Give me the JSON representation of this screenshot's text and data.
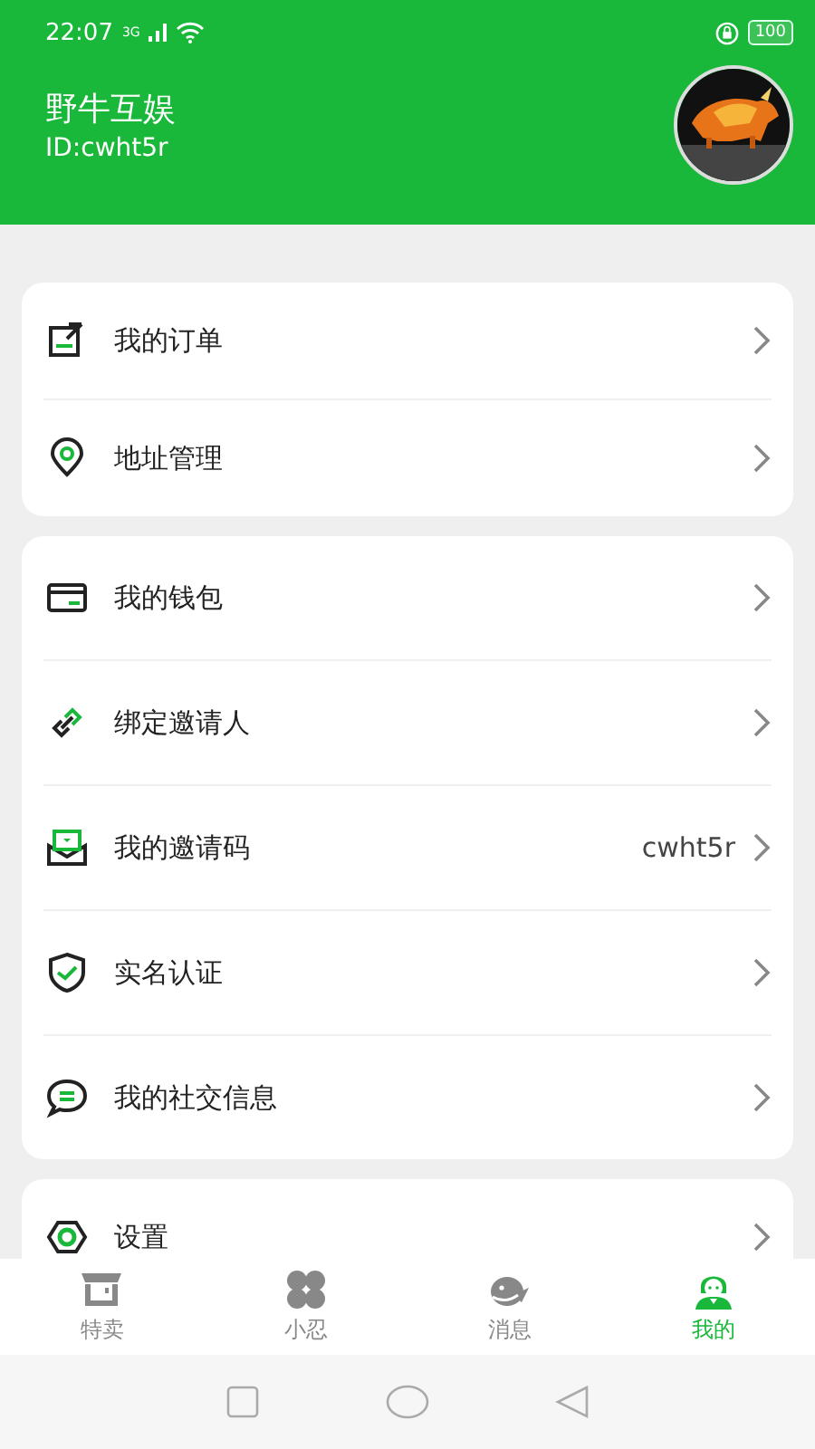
{
  "status_bar": {
    "time": "22:07",
    "network": "3G",
    "battery": "100"
  },
  "profile": {
    "name": "野牛互娱",
    "id": "ID:cwht5r"
  },
  "menu_groups": [
    {
      "items": [
        {
          "label": "我的订单"
        },
        {
          "label": "地址管理"
        }
      ]
    },
    {
      "items": [
        {
          "label": "我的钱包"
        },
        {
          "label": "绑定邀请人"
        },
        {
          "label": "我的邀请码",
          "value": "cwht5r"
        },
        {
          "label": "实名认证"
        },
        {
          "label": "我的社交信息"
        }
      ]
    },
    {
      "items": [
        {
          "label": "设置"
        }
      ]
    }
  ],
  "tabs": [
    {
      "label": "特卖",
      "selected": false
    },
    {
      "label": "小忍",
      "selected": false
    },
    {
      "label": "消息",
      "selected": false
    },
    {
      "label": "我的",
      "selected": true
    }
  ]
}
